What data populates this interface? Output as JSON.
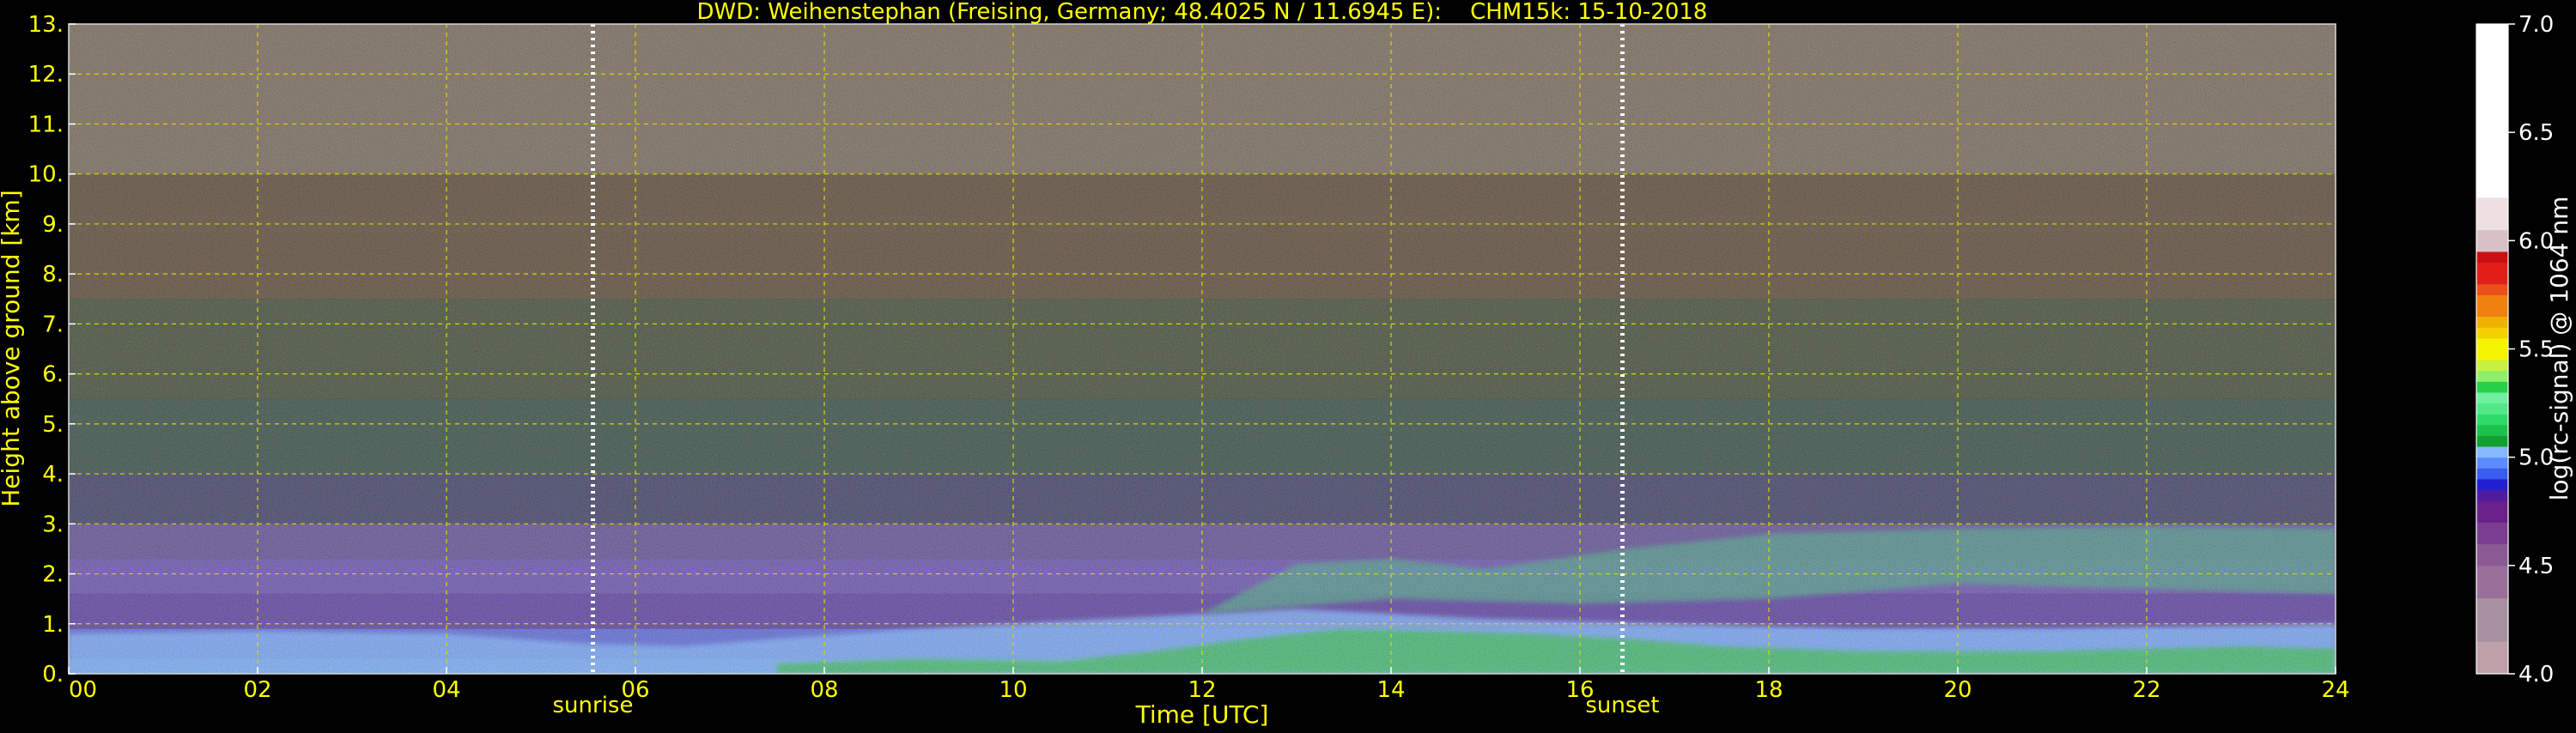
{
  "chart_data": {
    "type": "heatmap",
    "title": "DWD: Weihenstephan (Freising, Germany; 48.4025 N / 11.6945 E):    CHM15k: 15-10-2018",
    "xlabel": "Time [UTC]",
    "ylabel": "Height above ground [km]",
    "xlim": [
      0,
      24
    ],
    "ylim": [
      0,
      13
    ],
    "x_ticks": [
      "00",
      "02",
      "04",
      "06",
      "08",
      "10",
      "12",
      "14",
      "16",
      "18",
      "20",
      "22",
      "24"
    ],
    "y_ticks": [
      "0.",
      "1.",
      "2.",
      "3.",
      "4.",
      "5.",
      "6.",
      "7.",
      "8.",
      "9.",
      "10.",
      "11.",
      "12.",
      "13."
    ],
    "grid": true,
    "annotations": [
      {
        "label": "sunrise",
        "x": 5.55
      },
      {
        "label": "sunset",
        "x": 16.45
      }
    ],
    "colorbar": {
      "label": "log(rc-signal) @ 1064 nm",
      "range": [
        4.0,
        7.0
      ],
      "ticks": [
        "4.0",
        "4.5",
        "5.0",
        "5.5",
        "6.0",
        "6.5",
        "7.0"
      ],
      "palette": [
        {
          "from": 4.0,
          "to": 4.15,
          "color": "#c0a0a8"
        },
        {
          "from": 4.15,
          "to": 4.35,
          "color": "#a890a0"
        },
        {
          "from": 4.35,
          "to": 4.5,
          "color": "#9a6f9a"
        },
        {
          "from": 4.5,
          "to": 4.6,
          "color": "#8a5a95"
        },
        {
          "from": 4.6,
          "to": 4.7,
          "color": "#7a3d8f"
        },
        {
          "from": 4.7,
          "to": 4.8,
          "color": "#6a1f8a"
        },
        {
          "from": 4.8,
          "to": 4.85,
          "color": "#4f1a9e"
        },
        {
          "from": 4.85,
          "to": 4.9,
          "color": "#2020d0"
        },
        {
          "from": 4.9,
          "to": 4.95,
          "color": "#3a5cf0"
        },
        {
          "from": 4.95,
          "to": 5.0,
          "color": "#5a8cff"
        },
        {
          "from": 5.0,
          "to": 5.05,
          "color": "#86b8ff"
        },
        {
          "from": 5.05,
          "to": 5.1,
          "color": "#12a030"
        },
        {
          "from": 5.1,
          "to": 5.15,
          "color": "#1ec24a"
        },
        {
          "from": 5.15,
          "to": 5.2,
          "color": "#2edb6a"
        },
        {
          "from": 5.2,
          "to": 5.25,
          "color": "#52e888"
        },
        {
          "from": 5.25,
          "to": 5.3,
          "color": "#6ef0a0"
        },
        {
          "from": 5.3,
          "to": 5.35,
          "color": "#28d048"
        },
        {
          "from": 5.35,
          "to": 5.4,
          "color": "#8ef06a"
        },
        {
          "from": 5.4,
          "to": 5.45,
          "color": "#c8f040"
        },
        {
          "from": 5.45,
          "to": 5.55,
          "color": "#f4f400"
        },
        {
          "from": 5.55,
          "to": 5.6,
          "color": "#f4d000"
        },
        {
          "from": 5.6,
          "to": 5.65,
          "color": "#f0b000"
        },
        {
          "from": 5.65,
          "to": 5.75,
          "color": "#f08010"
        },
        {
          "from": 5.75,
          "to": 5.8,
          "color": "#e85018"
        },
        {
          "from": 5.8,
          "to": 5.9,
          "color": "#e02018"
        },
        {
          "from": 5.9,
          "to": 5.95,
          "color": "#c81010"
        },
        {
          "from": 5.95,
          "to": 6.05,
          "color": "#d8c0c4"
        },
        {
          "from": 6.05,
          "to": 6.2,
          "color": "#eee0e0"
        },
        {
          "from": 6.2,
          "to": 7.0,
          "color": "#ffffff"
        }
      ]
    },
    "background_bands": [
      {
        "from": 0.0,
        "to": 0.3,
        "color": "#5fa0f0"
      },
      {
        "from": 0.3,
        "to": 0.9,
        "color": "#4a5ad8"
      },
      {
        "from": 0.9,
        "to": 1.6,
        "color": "#4a2a9a"
      },
      {
        "from": 1.6,
        "to": 2.3,
        "color": "#5a3fa8"
      },
      {
        "from": 2.3,
        "to": 3.0,
        "color": "#503c8c"
      },
      {
        "from": 3.0,
        "to": 4.0,
        "color": "#2a2a55"
      },
      {
        "from": 4.0,
        "to": 5.5,
        "color": "#1f3a30"
      },
      {
        "from": 5.5,
        "to": 7.5,
        "color": "#2d3820"
      },
      {
        "from": 7.5,
        "to": 10.0,
        "color": "#4a3620"
      },
      {
        "from": 10.0,
        "to": 13.0,
        "color": "#6a5a48"
      }
    ],
    "features": [
      {
        "name": "surface-layer",
        "color": "#6ea8ff",
        "points": [
          [
            0,
            0
          ],
          [
            0,
            0.8
          ],
          [
            2,
            0.85
          ],
          [
            4,
            0.8
          ],
          [
            5.5,
            0.6
          ],
          [
            6.5,
            0.55
          ],
          [
            7.5,
            0.7
          ],
          [
            9,
            0.9
          ],
          [
            11,
            1.1
          ],
          [
            13,
            1.3
          ],
          [
            15,
            1.1
          ],
          [
            17,
            1.0
          ],
          [
            19,
            0.9
          ],
          [
            21,
            0.9
          ],
          [
            24,
            1.0
          ],
          [
            24,
            0
          ]
        ]
      },
      {
        "name": "near-ground-green",
        "color": "#20b848",
        "points": [
          [
            7.5,
            0
          ],
          [
            7.5,
            0.2
          ],
          [
            9,
            0.3
          ],
          [
            10.5,
            0.25
          ],
          [
            11.5,
            0.45
          ],
          [
            12.5,
            0.7
          ],
          [
            13.5,
            0.9
          ],
          [
            14.5,
            0.85
          ],
          [
            15.5,
            0.8
          ],
          [
            16.5,
            0.7
          ],
          [
            17.5,
            0.55
          ],
          [
            19,
            0.45
          ],
          [
            21,
            0.45
          ],
          [
            23,
            0.55
          ],
          [
            24,
            0.5
          ],
          [
            24,
            0
          ]
        ]
      },
      {
        "name": "residual-layer",
        "color": "#3a9080",
        "points": [
          [
            12,
            1.2
          ],
          [
            13,
            2.2
          ],
          [
            14,
            2.3
          ],
          [
            15,
            2.1
          ],
          [
            16.5,
            2.5
          ],
          [
            18,
            2.8
          ],
          [
            20,
            2.9
          ],
          [
            22,
            2.95
          ],
          [
            24,
            2.9
          ],
          [
            24,
            1.6
          ],
          [
            22,
            1.7
          ],
          [
            20,
            1.8
          ],
          [
            18,
            1.5
          ],
          [
            16,
            1.4
          ],
          [
            14,
            1.5
          ],
          [
            12,
            1.2
          ]
        ]
      }
    ]
  }
}
